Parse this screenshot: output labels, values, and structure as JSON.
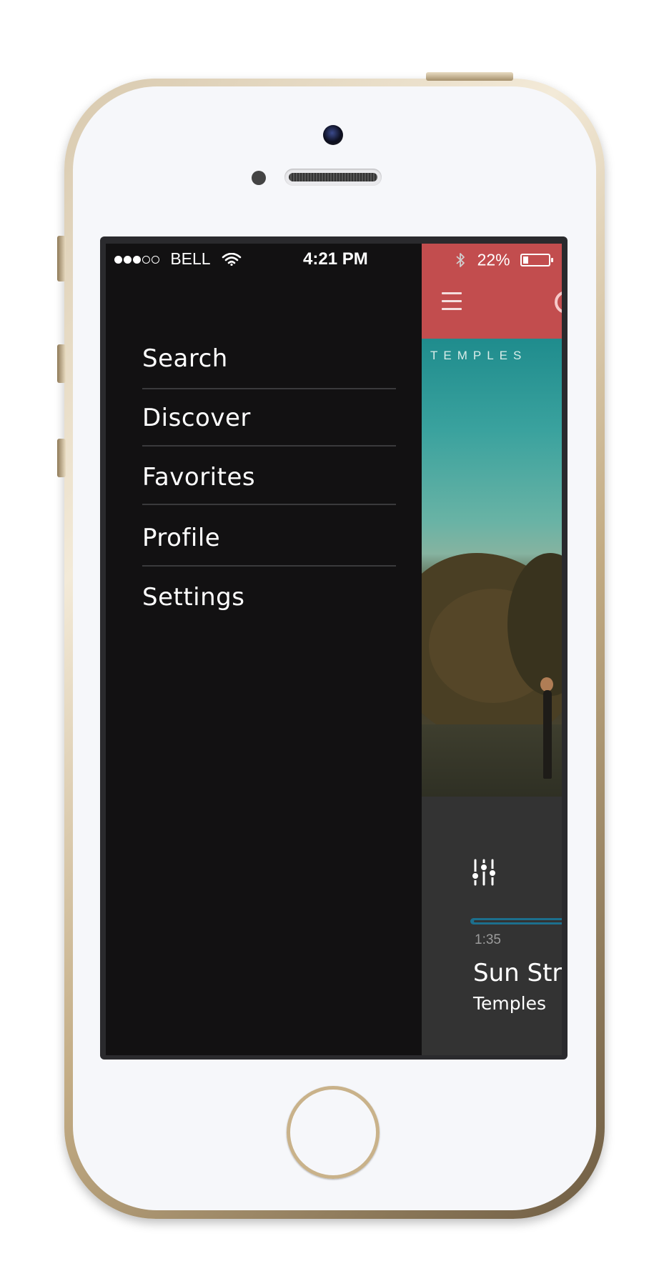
{
  "status_bar": {
    "carrier": "BELL",
    "time": "4:21 PM",
    "battery_percent": "22%",
    "battery_level": 0.22,
    "signal_bars_filled": 3,
    "signal_bars_total": 5
  },
  "side_menu": {
    "items": [
      {
        "label": "Search",
        "icon": "none"
      },
      {
        "label": "Discover",
        "icon": "none"
      },
      {
        "label": "Favorites",
        "icon": "none"
      },
      {
        "label": "Profile",
        "icon": "none"
      },
      {
        "label": "Settings",
        "icon": "none"
      }
    ]
  },
  "app_header": {
    "menu_icon": "hamburger-icon",
    "logo_icon": "logo-icon",
    "background_color": "#c24d4e"
  },
  "album": {
    "cover_text": "TEMPLES"
  },
  "player": {
    "elapsed": "1:35",
    "track_title": "Sun Str",
    "artist": "Temples",
    "accent_color": "#1c6f8d"
  }
}
